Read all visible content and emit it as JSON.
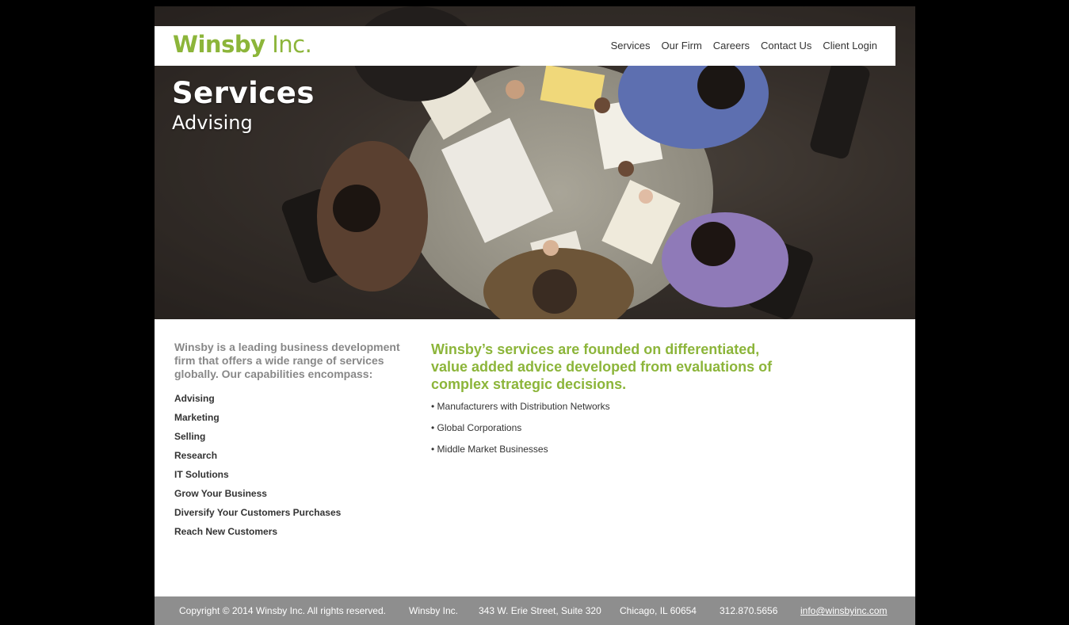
{
  "logo": {
    "name": "Winsby",
    "suffix": "Inc."
  },
  "nav": {
    "items": [
      {
        "label": "Services"
      },
      {
        "label": "Our Firm"
      },
      {
        "label": "Careers"
      },
      {
        "label": "Contact Us"
      },
      {
        "label": "Client Login"
      }
    ]
  },
  "hero": {
    "title": "Services",
    "subtitle": "Advising"
  },
  "intro": "Winsby is a leading business development firm that offers a wide range of services globally. Our capabilities encompass:",
  "capabilities": [
    "Advising",
    "Marketing",
    "Selling",
    "Research",
    "IT Solutions",
    "Grow Your Business",
    "Diversify Your Customers Purchases",
    "Reach New Customers"
  ],
  "main": {
    "headline": "Winsby’s services are founded on differentiated, value added advice developed from evaluations of complex strategic decisions.",
    "bullets": [
      "• Manufacturers with Distribution Networks",
      "• Global Corporations",
      "• Middle Market Businesses"
    ]
  },
  "footer": {
    "copyright": "Copyright © 2014 Winsby Inc. All rights reserved.",
    "company": "Winsby Inc.",
    "address": "343 W. Erie Street, Suite 320",
    "city": "Chicago, IL 60654",
    "phone": "312.870.5656",
    "email": "info@winsbyinc.com"
  },
  "colors": {
    "brand_green": "#8cb53a",
    "footer_bg": "#8e8e8e",
    "page_bg": "#000000"
  }
}
